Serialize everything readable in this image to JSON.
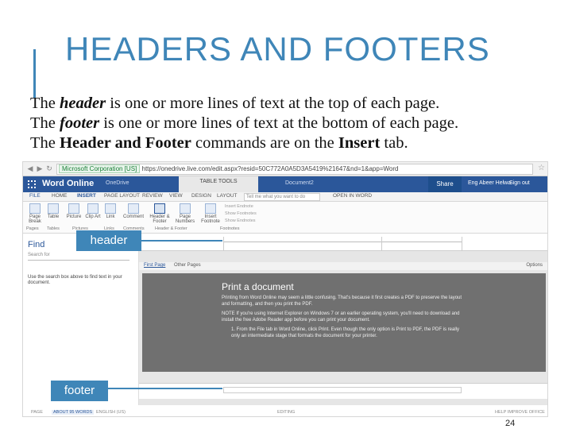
{
  "slide": {
    "title": "HEADERS AND FOOTERS",
    "page_number": "24",
    "lines": [
      {
        "pre": "The ",
        "em": "header",
        "post": " is one or more lines of text at the top of each page."
      },
      {
        "pre": "The ",
        "em": "footer",
        "post": " is one or more lines of text at the bottom of each page."
      },
      {
        "pre": "The ",
        "strong1": "Header and Footer",
        "mid": " commands are on the ",
        "strong2": "Insert",
        "post": " tab."
      }
    ],
    "callouts": {
      "header": "header",
      "footer": "footer"
    }
  },
  "screenshot": {
    "browser": {
      "secure_label": "Microsoft Corporation [US]",
      "url": "https://onedrive.live.com/edit.aspx?resid=50C772A0A5D3A5419%21647&nd=1&app=Word"
    },
    "app_bar": {
      "app_name": "Word Online",
      "app_sub": "OneDrive",
      "tools_tab": "TABLE TOOLS",
      "doc_name": "Document2",
      "share": "Share",
      "user": "Eng Abeer Helwa",
      "signout": "Sign out"
    },
    "ribbon_tabs": [
      "FILE",
      "HOME",
      "INSERT",
      "PAGE LAYOUT",
      "REVIEW",
      "VIEW",
      "DESIGN",
      "LAYOUT"
    ],
    "tell_me": "Tell me what you want to do",
    "open_in_word": "OPEN IN WORD",
    "ribbon_groups": {
      "page_break": "Page Break",
      "table": "Table",
      "picture": "Picture",
      "clip_art": "Clip Art",
      "link": "Link",
      "comment": "Comment",
      "header_footer": "Header & Footer",
      "page_numbers": "Page Numbers",
      "insert_footnote": "Insert Footnote",
      "insert_endnote": "Insert Endnote",
      "show_footnotes": "Show Footnotes",
      "show_endnotes": "Show Endnotes"
    },
    "group_labels": [
      "Pages",
      "Tables",
      "Pictures",
      "Links",
      "Comments",
      "Header & Footer",
      "Footnotes"
    ],
    "find_pane": {
      "title": "Find",
      "placeholder": "Search for",
      "hint": "Use the search box above to find text in your document."
    },
    "pane_tabs": {
      "first": "First Page",
      "other": "Other Pages",
      "options": "Options"
    },
    "document": {
      "heading": "Print a document",
      "para1": "Printing from Word Online may seem a little confusing. That's because it first creates a PDF to preserve the layout and formatting, and then you print the PDF.",
      "para2": "NOTE   If you're using Internet Explorer on Windows 7 or an earlier operating system, you'll need to download and install the free Adobe Reader app before you can print your document.",
      "step": "1.  From the File tab in Word Online, click Print. Even though the only option is Print to PDF, the PDF is really only an intermediate stage that formats the document for your printer."
    },
    "status": [
      "PAGE",
      "ABOUT 95 WORDS",
      "ENGLISH (US)",
      "EDITING",
      "HELP IMPROVE OFFICE"
    ]
  }
}
